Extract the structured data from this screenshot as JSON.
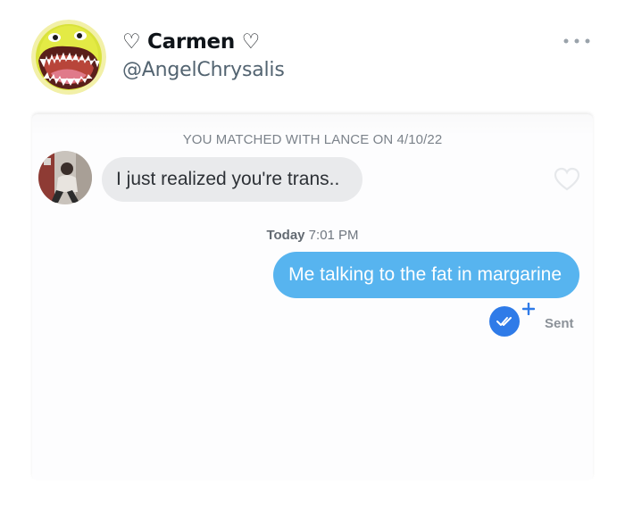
{
  "tweet": {
    "display_name": "♡ Carmen ♡",
    "handle": "@AngelChrysalis",
    "avatar_icon": "yellow-monster-face-icon",
    "more_icon": "ellipsis-icon"
  },
  "chat": {
    "matched_text": "YOU MATCHED WITH LANCE ON 4/10/22",
    "incoming_message": "I just realized you're trans..",
    "like_icon": "heart-outline-icon",
    "timestamp_day": "Today",
    "timestamp_time": " 7:01 PM",
    "outgoing_message": "Me talking to the fat in margarine",
    "read_icon": "double-check-icon",
    "status": "Sent"
  },
  "colors": {
    "outgoing_bubble": "#57b4ef",
    "incoming_bubble": "#e9eaec",
    "read_badge": "#2f7be8"
  }
}
